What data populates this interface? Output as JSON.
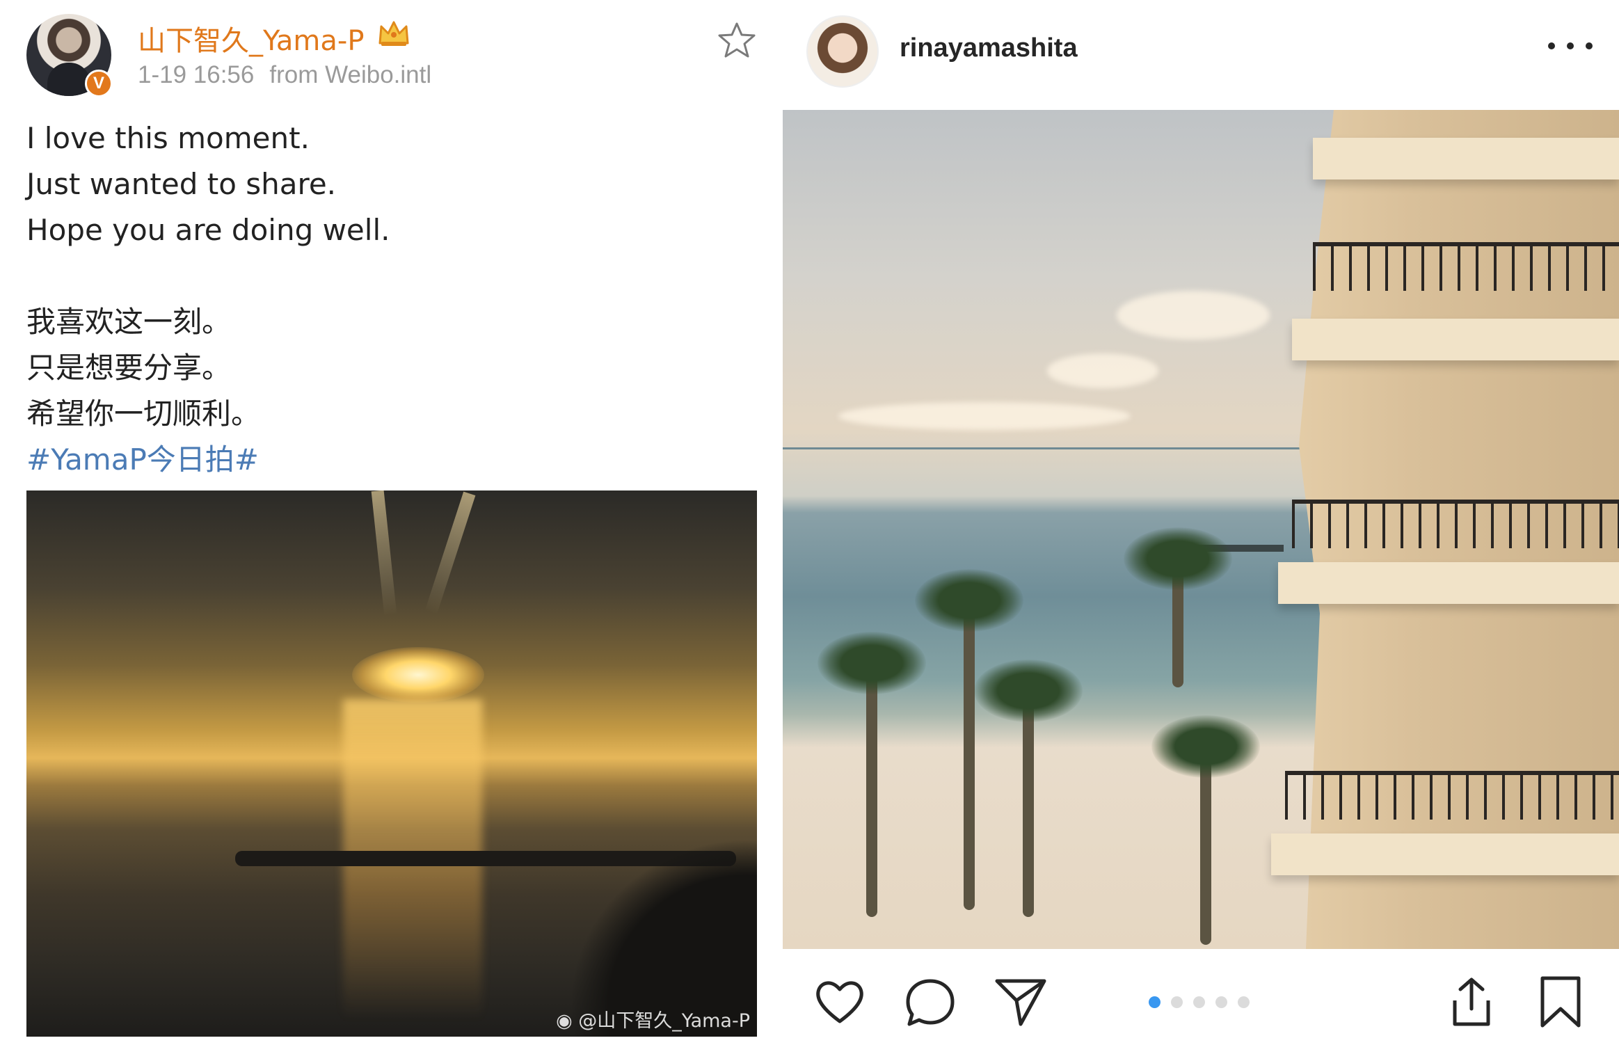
{
  "weibo": {
    "username": "山下智久_Yama-P",
    "verified_badge": "V",
    "timestamp": "1-19 16:56",
    "source": "from Weibo.intl",
    "post_lines_en": [
      "I love this moment.",
      "Just wanted to share.",
      "Hope you are doing well."
    ],
    "post_lines_zh": [
      "我喜欢这一刻。",
      "只是想要分享。",
      "希望你一切顺利。"
    ],
    "hashtag": "#YamaP今日拍#",
    "photo_watermark": "@山下智久_Yama-P",
    "icons": {
      "favorite": "star-icon",
      "member": "crown-icon"
    },
    "colors": {
      "username": "#e0781b",
      "hashtag": "#4b7bb5",
      "badge": "#e2781c"
    }
  },
  "instagram": {
    "username": "rinayamashita",
    "carousel": {
      "total": 5,
      "active_index": 1
    },
    "icons": {
      "more": "more-dots-icon",
      "like": "heart-icon",
      "comment": "comment-bubble-icon",
      "share": "paper-plane-icon",
      "upload": "share-upload-icon",
      "save": "bookmark-icon"
    },
    "colors": {
      "active_dot": "#3897f0",
      "inactive_dot": "#dbdbdb",
      "text": "#262626"
    }
  }
}
